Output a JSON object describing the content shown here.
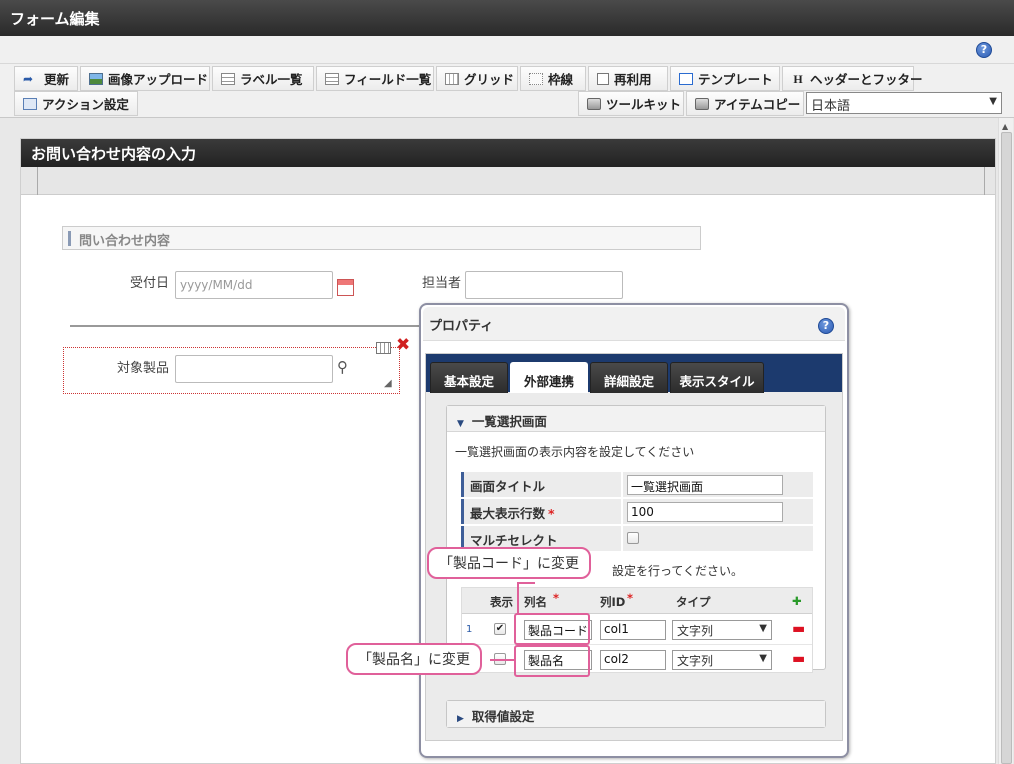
{
  "window": {
    "title": "フォーム編集"
  },
  "toolbar": {
    "row1": [
      {
        "label": "更新",
        "icon": "update-icon"
      },
      {
        "label": "画像アップロード",
        "icon": "image-upload-icon"
      },
      {
        "label": "ラベル一覧",
        "icon": "label-list-icon"
      },
      {
        "label": "フィールド一覧",
        "icon": "field-list-icon"
      },
      {
        "label": "グリッド",
        "icon": "grid-icon"
      },
      {
        "label": "枠線",
        "icon": "border-icon"
      },
      {
        "label": "再利用",
        "icon": "reuse-icon"
      },
      {
        "label": "テンプレート",
        "icon": "template-icon"
      },
      {
        "label": "ヘッダーとフッター",
        "icon": "header-footer-icon"
      }
    ],
    "row2": [
      {
        "label": "アクション設定",
        "icon": "action-icon"
      },
      {
        "label": "ツールキット",
        "icon": "toolkit-icon"
      },
      {
        "label": "アイテムコピー",
        "icon": "item-copy-icon"
      }
    ],
    "language": "日本語"
  },
  "form": {
    "header": "お問い合わせ内容の入力",
    "section_title": "問い合わせ内容",
    "reception_date_label": "受付日",
    "reception_date_placeholder": "yyyy/MM/dd",
    "assignee_label": "担当者",
    "product_label": "対象製品"
  },
  "properties": {
    "title": "プロパティ",
    "tabs": [
      "基本設定",
      "外部連携",
      "詳細設定",
      "表示スタイル"
    ],
    "active_tab": "外部連携",
    "list_section": {
      "title": "一覧選択画面",
      "description": "一覧選択画面の表示内容を設定してください",
      "rows": [
        {
          "key": "画面タイトル",
          "value": "一覧選択画面"
        },
        {
          "key": "最大表示行数",
          "value": "100",
          "required": "*"
        },
        {
          "key": "マルチセレクト"
        }
      ],
      "columns_note": "設定を行ってください。",
      "column_headers": {
        "display": "表示",
        "name": "列名",
        "id": "列ID",
        "type": "タイプ"
      },
      "column_rows": [
        {
          "num": "1",
          "checked": true,
          "name": "製品コード",
          "id": "col1",
          "type": "文字列"
        },
        {
          "num": "",
          "checked": false,
          "name": "製品名",
          "id": "col2",
          "type": "文字列"
        }
      ]
    },
    "value_section": {
      "title": "取得値設定"
    }
  },
  "callouts": {
    "code": "「製品コード」に変更",
    "name": "「製品名」に変更"
  },
  "colors": {
    "accent": "#e0609a",
    "tab_bar": "#1c3a6e",
    "required": "#dd2222"
  }
}
